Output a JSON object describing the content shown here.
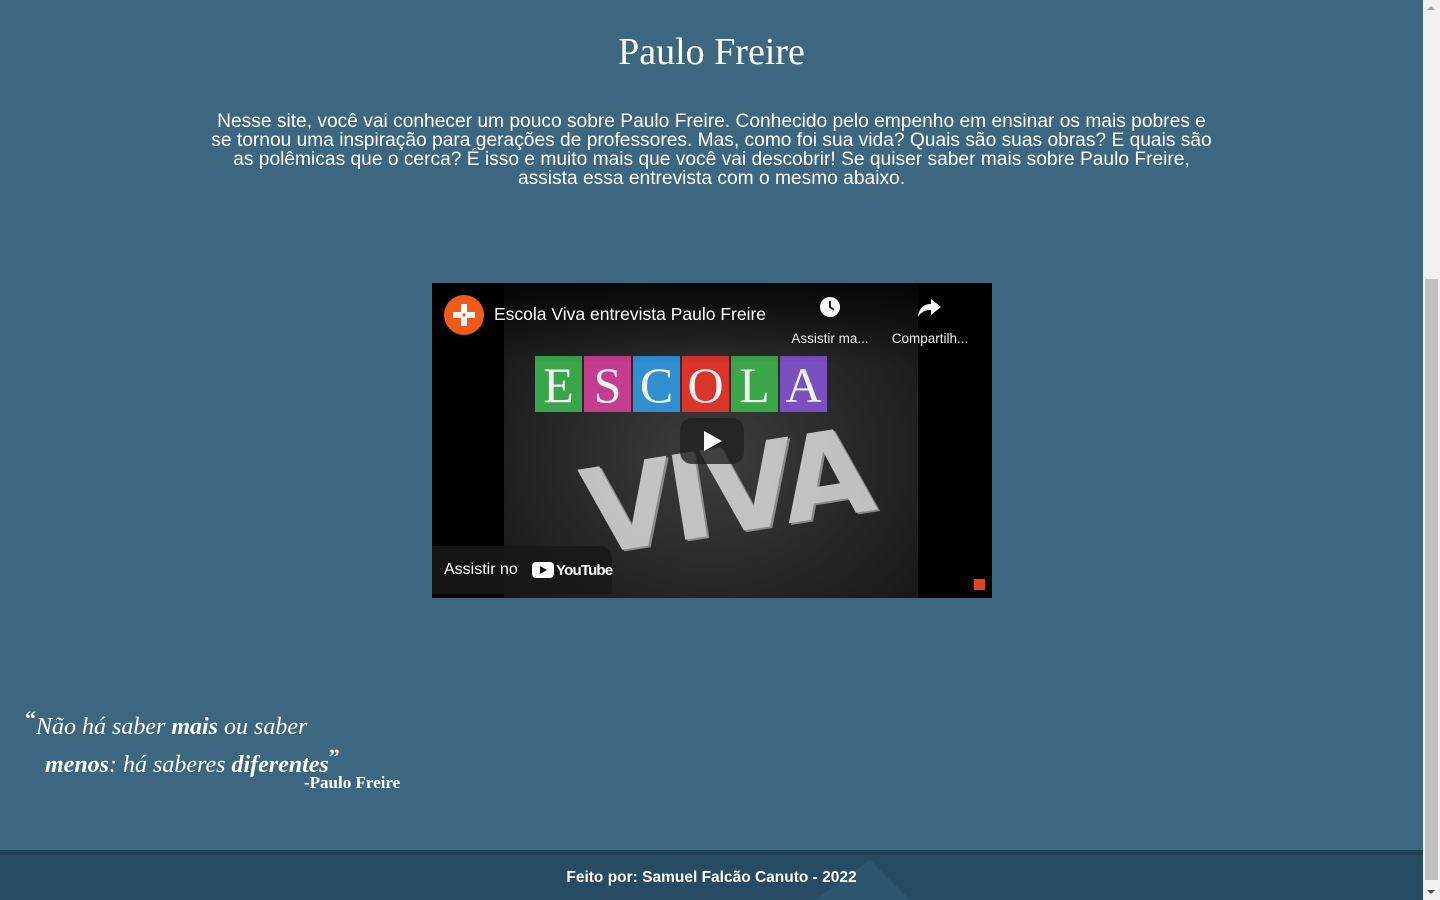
{
  "page": {
    "title": "Paulo Freire",
    "intro": "Nesse site, você vai conhecer um pouco sobre Paulo Freire. Conhecido pelo empenho em ensinar os mais pobres e se tornou uma inspiração para gerações de professores. Mas, como foi sua vida? Quais são suas obras? E quais são as polêmicas que o cerca? É isso e muito mais que você vai descobrir! Se quiser saber mais sobre Paulo Freire, assista essa entrevista com o mesmo abaixo."
  },
  "video": {
    "title": "Escola Viva entrevista Paulo Freire",
    "watch_later_label": "Assistir ma...",
    "share_label": "Compartilh...",
    "watch_on_label": "Assistir no",
    "platform_word": "YouTube",
    "thumbnail_word1_letters": [
      "E",
      "S",
      "C",
      "O",
      "L",
      "A"
    ],
    "thumbnail_word2": "VIVA",
    "letter_colors": [
      "#3aa64a",
      "#c53d8e",
      "#2f8fd0",
      "#d9352a",
      "#3aa64a",
      "#7a4fc0"
    ],
    "channel_color": "#f05a1a"
  },
  "quote": {
    "open_mark": "“",
    "part1": "Não há saber ",
    "part1_bold": "mais",
    "part2": " ou saber",
    "part3_bold": "menos",
    "part4": ": há saberes ",
    "part4_bold": "diferentes",
    "close_mark": "”",
    "author": "-Paulo Freire"
  },
  "footer": {
    "text": "Feito por: Samuel Falcão Canuto - 2022"
  },
  "colors": {
    "background": "#3d6780",
    "footer": "#274b62"
  }
}
